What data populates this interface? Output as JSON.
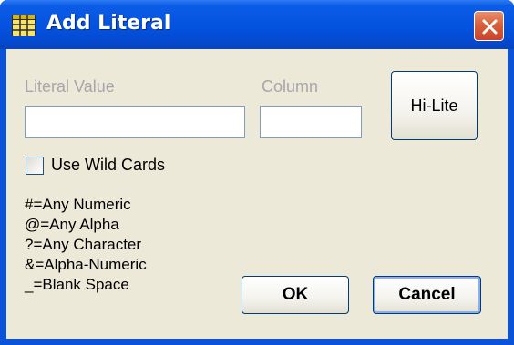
{
  "dialog": {
    "title": "Add Literal",
    "icon": "table-grid-icon",
    "close_icon": "close-x-icon",
    "accent_color": "#0554e0",
    "close_color": "#d9613b",
    "background_color": "#ece9d8"
  },
  "form": {
    "literal_value_label": "Literal Value",
    "literal_value": "",
    "column_label": "Column",
    "column_value": "",
    "hilite_label": "Hi-Lite",
    "use_wild_cards_label": "Use Wild Cards",
    "use_wild_cards_checked": false
  },
  "legend": [
    "#=Any Numeric",
    "@=Any Alpha",
    "?=Any Character",
    "&=Alpha-Numeric",
    "_=Blank Space"
  ],
  "buttons": {
    "ok": "OK",
    "cancel": "Cancel"
  }
}
